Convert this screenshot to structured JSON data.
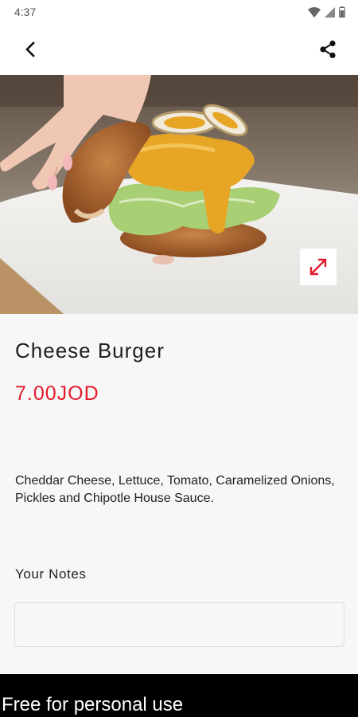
{
  "status_bar": {
    "time": "4:37"
  },
  "app_bar": {
    "back_icon": "chevron-left-icon",
    "share_icon": "share-icon"
  },
  "product": {
    "image": "cheese-burger-photo",
    "name": "Cheese Burger",
    "price": "7.00JOD",
    "description": "Cheddar Cheese, Lettuce, Tomato, Caramelized Onions, Pickles and Chipotle House Sauce."
  },
  "notes": {
    "label": "Your Notes",
    "value": ""
  },
  "watermark": "Free for personal use",
  "colors": {
    "accent": "#e41b2c",
    "background": "#f7f7f7",
    "bottom_bar": "#000000"
  }
}
